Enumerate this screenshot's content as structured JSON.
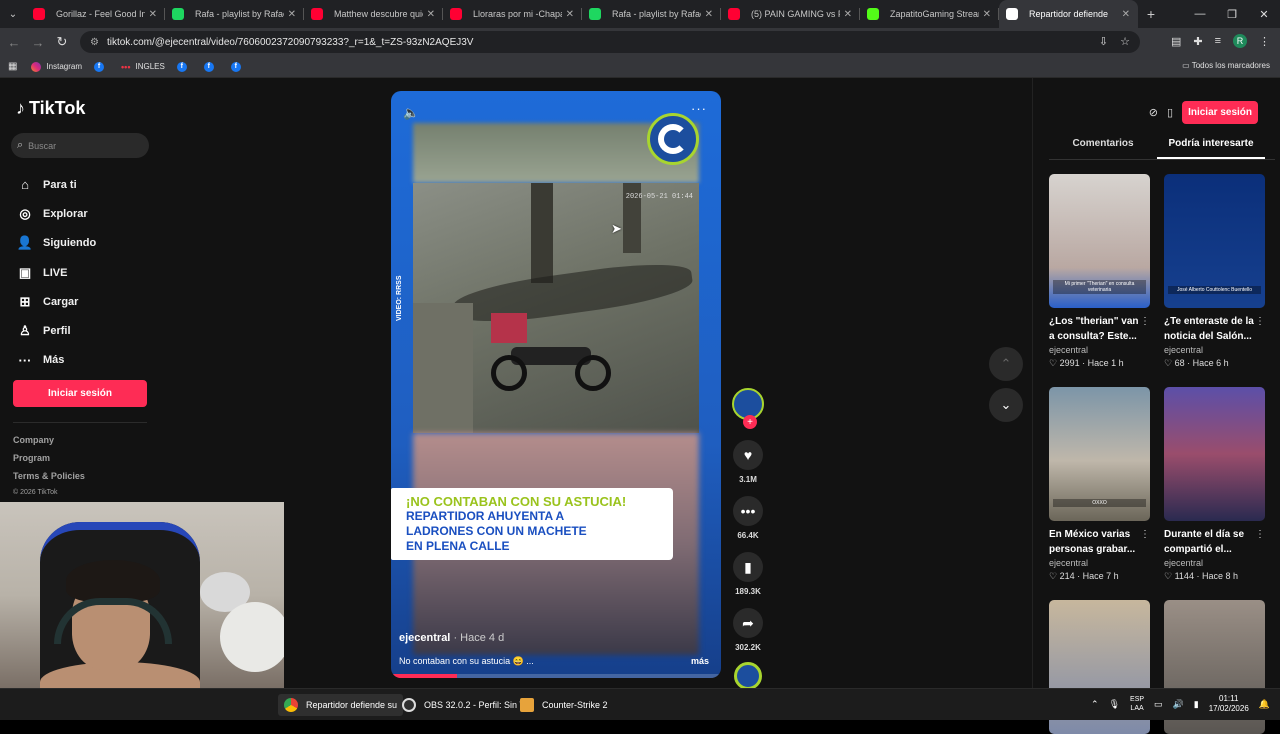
{
  "browser": {
    "tabs": [
      {
        "title": "Gorillaz - Feel Good Inc.",
        "color": "#ff0033",
        "active": false
      },
      {
        "title": "Rafa - playlist by Rafael.x",
        "color": "#1ed760",
        "active": false
      },
      {
        "title": "Matthew descubre quién",
        "color": "#ff0033",
        "active": false
      },
      {
        "title": "Lloraras por mi -Chapa C",
        "color": "#ff0033",
        "active": false
      },
      {
        "title": "Rafa - playlist by Rafael.x",
        "color": "#1ed760",
        "active": false
      },
      {
        "title": "(5) PAIN GAMING vs PAR",
        "color": "#ff0033",
        "active": false
      },
      {
        "title": "ZapatitoGaming Stream",
        "color": "#53fc18",
        "active": false
      },
      {
        "title": "Repartidor defiende",
        "color": "#ffffff",
        "active": true
      }
    ],
    "url": "tiktok.com/@ejecentral/video/7606002372090793233?_r=1&_t=ZS-93zN2AQEJ3V",
    "bookmarks": [
      {
        "label": "Instagram",
        "kind": "instagram"
      },
      {
        "label": "",
        "kind": "facebook"
      },
      {
        "label": "INGLES",
        "kind": "dots"
      },
      {
        "label": "",
        "kind": "facebook"
      },
      {
        "label": "",
        "kind": "facebook"
      },
      {
        "label": "",
        "kind": "facebook"
      }
    ],
    "all_bookmarks": "Todos los marcadores",
    "profile_initial": "R"
  },
  "sidebar": {
    "logo": "TikTok",
    "search_placeholder": "Buscar",
    "nav": [
      {
        "label": "Para ti",
        "icon": "home-icon",
        "glyph": "⌂"
      },
      {
        "label": "Explorar",
        "icon": "compass-icon",
        "glyph": "◎"
      },
      {
        "label": "Siguiendo",
        "icon": "following-icon",
        "glyph": "👤"
      },
      {
        "label": "LIVE",
        "icon": "live-icon",
        "glyph": "▣"
      },
      {
        "label": "Cargar",
        "icon": "upload-icon",
        "glyph": "⊞"
      },
      {
        "label": "Perfil",
        "icon": "profile-icon",
        "glyph": "♙"
      },
      {
        "label": "Más",
        "icon": "more-icon",
        "glyph": "···"
      }
    ],
    "login": "Iniciar sesión",
    "footer": [
      "Company",
      "Program",
      "Terms & Policies"
    ],
    "copyright": "© 2026 TikTok"
  },
  "video": {
    "caption_line1": "¡NO CONTABAN CON SU ASTUCIA!",
    "caption_line2": "REPARTIDOR AHUYENTA A",
    "caption_line3": "LADRONES CON UN MACHETE",
    "caption_line4": "EN PLENA CALLE",
    "credit": "VIDEO: RRSS",
    "timestamp": "2026-05-21 01:44",
    "author": "ejecentral",
    "posted": "· Hace 4 d",
    "description": "No contaban con su astucia 😄 ...",
    "more": "más",
    "progress": 0.2
  },
  "actions": {
    "likes": "3.1M",
    "comments": "66.4K",
    "saves": "189.3K",
    "shares": "302.2K"
  },
  "right_panel": {
    "login": "Iniciar sesión",
    "tabs": [
      "Comentarios",
      "Podría interesarte"
    ],
    "cards": [
      {
        "title": "¿Los \"therian\" van a consulta? Este...",
        "user": "ejecentral",
        "likes": "2991",
        "ago": "Hace 1 h",
        "thumb_text": "Mi primer \"Therian\" en consulta veterinaria"
      },
      {
        "title": "¿Te enteraste de la noticia del Salón...",
        "user": "ejecentral",
        "likes": "68",
        "ago": "Hace 6 h",
        "thumb_text": "José Alberto Couttolenc Buentello"
      },
      {
        "title": "En México varias personas grabar...",
        "user": "ejecentral",
        "likes": "214",
        "ago": "Hace 7 h",
        "thumb_text": "OXXO"
      },
      {
        "title": "Durante el día se compartió el...",
        "user": "ejecentral",
        "likes": "1144",
        "ago": "Hace 8 h",
        "thumb_text": ""
      },
      {
        "title": "",
        "user": "",
        "likes": "",
        "ago": "",
        "thumb_text": ""
      },
      {
        "title": "",
        "user": "",
        "likes": "",
        "ago": "",
        "thumb_text": ""
      }
    ]
  },
  "taskbar": {
    "tasks": [
      "Repartidor defiende su",
      "OBS 32.0.2 - Perfil: Sin T",
      "Counter-Strike 2"
    ],
    "lang1": "ESP",
    "lang2": "LAA",
    "time": "01:11",
    "date": "17/02/2026"
  }
}
